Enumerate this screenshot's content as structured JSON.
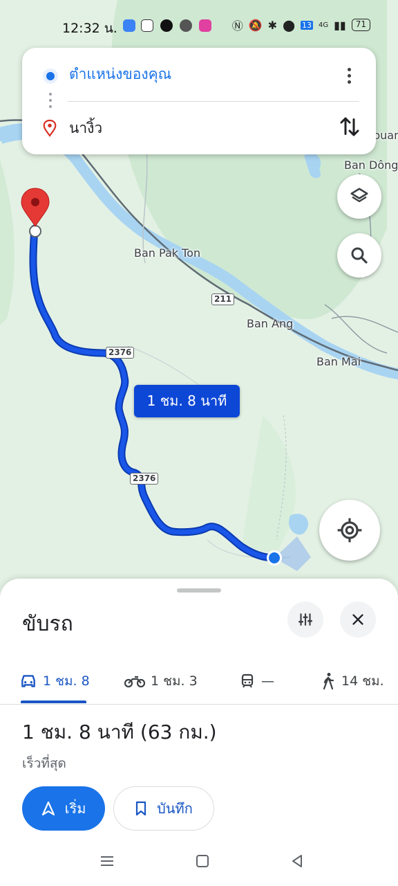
{
  "status_bar": {
    "time": "12:32 น.",
    "signal_badge": "13",
    "network": "4G",
    "battery": "71"
  },
  "search_card": {
    "origin": "ตำแหน่งของคุณ",
    "destination": "นางิ้ว"
  },
  "map": {
    "labels": {
      "ban_pak_ton": "Ban Pak Ton",
      "ban_ang": "Ban Ang",
      "ban_mai": "Ban Mai",
      "ban_dong": "Ban Dông",
      "edge_puan": "puan"
    },
    "shields": {
      "road_211": "211",
      "road_2376_a": "2376",
      "road_2376_b": "2376"
    },
    "duration_callout": "1 ชม. 8 นาที",
    "route_color": "#1a56e8",
    "water_color": "#a8d4f2"
  },
  "sheet": {
    "title": "ขับรถ",
    "modes": [
      {
        "label": "1 ชม. 8",
        "icon": "car-icon"
      },
      {
        "label": "1 ชม. 3",
        "icon": "motorcycle-icon"
      },
      {
        "label": "—",
        "icon": "train-icon"
      },
      {
        "label": "14 ชม.",
        "icon": "walk-icon"
      }
    ],
    "summary": "1 ชม. 8 นาที (63 กม.)",
    "subtitle": "เร็วที่สุด",
    "start_label": "เริ่ม",
    "save_label": "บันทึก",
    "accent": "#1a73e8"
  }
}
